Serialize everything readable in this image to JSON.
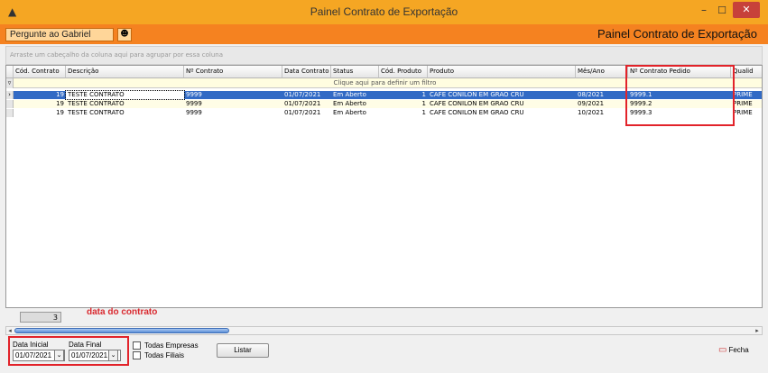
{
  "window": {
    "title": "Painel Contrato de Exportação",
    "minimize_label": "–",
    "maximize_label": "☐",
    "close_label": "✕"
  },
  "header": {
    "ask_field_value": "Pergunte ao Gabriel",
    "title": "Painel Contrato de Exportação"
  },
  "grid": {
    "group_hint": "Arraste um cabeçalho da coluna aqui para agrupar por essa coluna",
    "filter_hint": "Clique aqui para definir um filtro",
    "columns": [
      "Cód. Contrato",
      "Descrição",
      "Nº Contrato",
      "Data Contrato",
      "Status",
      "Cód. Produto",
      "Produto",
      "Mês/Ano",
      "Nº Contrato Pedido",
      "Qualid"
    ],
    "rows": [
      {
        "cod": "19",
        "descricao": "TESTE CONTRATO",
        "numero": "9999",
        "data": "01/07/2021",
        "status": "Em Aberto",
        "cod_produto": "1",
        "produto": "CAFE CONILON EM GRAO CRU",
        "mes_ano": "08/2021",
        "pedido": "9999.1",
        "qualidade": "PRIME"
      },
      {
        "cod": "19",
        "descricao": "TESTE CONTRATO",
        "numero": "9999",
        "data": "01/07/2021",
        "status": "Em Aberto",
        "cod_produto": "1",
        "produto": "CAFE CONILON EM GRAO CRU",
        "mes_ano": "09/2021",
        "pedido": "9999.2",
        "qualidade": "PRIME"
      },
      {
        "cod": "19",
        "descricao": "TESTE CONTRATO",
        "numero": "9999",
        "data": "01/07/2021",
        "status": "Em Aberto",
        "cod_produto": "1",
        "produto": "CAFE CONILON EM GRAO CRU",
        "mes_ano": "10/2021",
        "pedido": "9999.3",
        "qualidade": "PRIME"
      }
    ],
    "record_count": "3",
    "annotation": "data do contrato"
  },
  "footer": {
    "start_label": "Data Inicial",
    "start_value": "01/07/2021",
    "end_label": "Data Final",
    "end_value": "01/07/2021",
    "all_companies_label": "Todas Empresas",
    "all_branches_label": "Todas Filiais",
    "list_button": "Listar",
    "close_button": "Fecha"
  },
  "colors": {
    "titlebar": "#f5a623",
    "header": "#f58220",
    "selection": "#316ac5",
    "highlight": "#e2232a"
  }
}
